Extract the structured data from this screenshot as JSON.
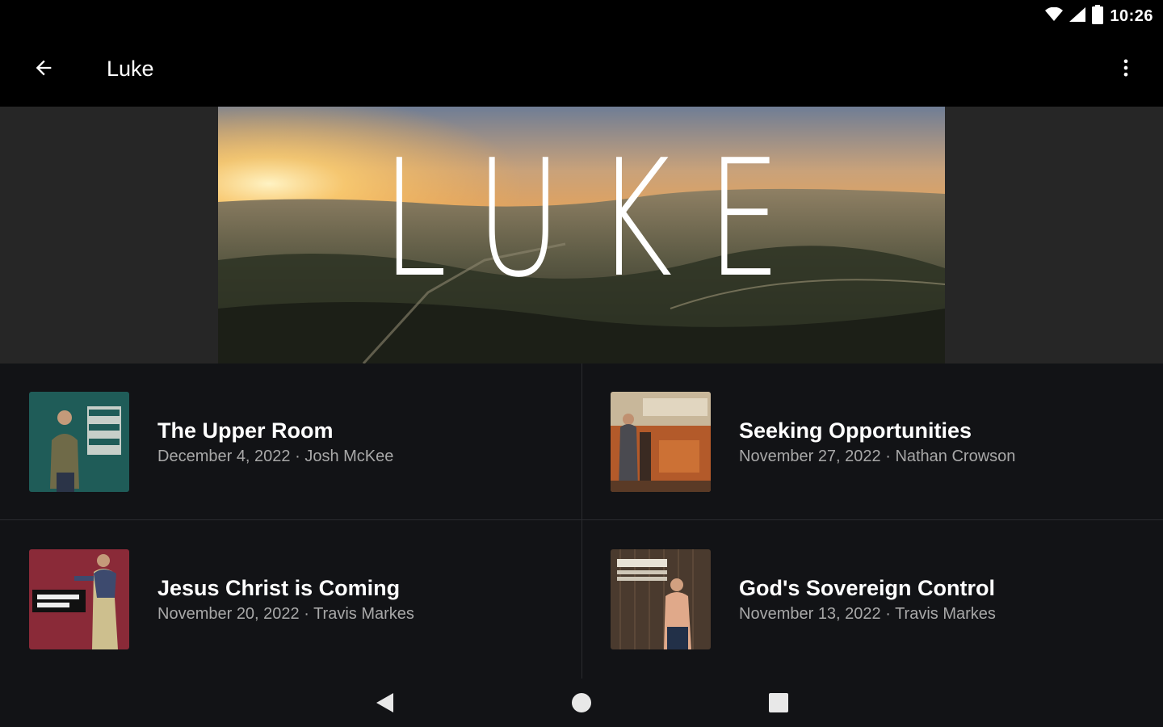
{
  "status_bar": {
    "time": "10:26",
    "icons": [
      "wifi-icon",
      "cell-signal-icon",
      "battery-icon"
    ]
  },
  "app_bar": {
    "title": "Luke",
    "back_icon": "arrow-back-icon",
    "menu_icon": "more-vert-icon"
  },
  "hero": {
    "title": "LUKE"
  },
  "sermons": [
    {
      "title": "The Upper Room",
      "subtitle": "December 4, 2022 · Josh McKee",
      "thumb_text": "THE UPPER ROOM"
    },
    {
      "title": "Seeking Opportunities",
      "subtitle": "November 27, 2022 · Nathan Crowson"
    },
    {
      "title": "Jesus Christ is Coming",
      "subtitle": "November 20, 2022 · Travis Markes",
      "thumb_text": "Jesus Christ is Coming"
    },
    {
      "title": "God's Sovereign Control",
      "subtitle": "November 13, 2022 · Travis Markes",
      "thumb_text": "GOD'S SOVEREIGN CONTROL"
    }
  ],
  "nav_bar": {
    "icons": [
      "nav-back-icon",
      "nav-home-icon",
      "nav-recents-icon"
    ]
  },
  "colors": {
    "background": "#000000",
    "list_background": "#121316",
    "subtitle": "#a8a8a8",
    "hero_band": "#262626"
  }
}
